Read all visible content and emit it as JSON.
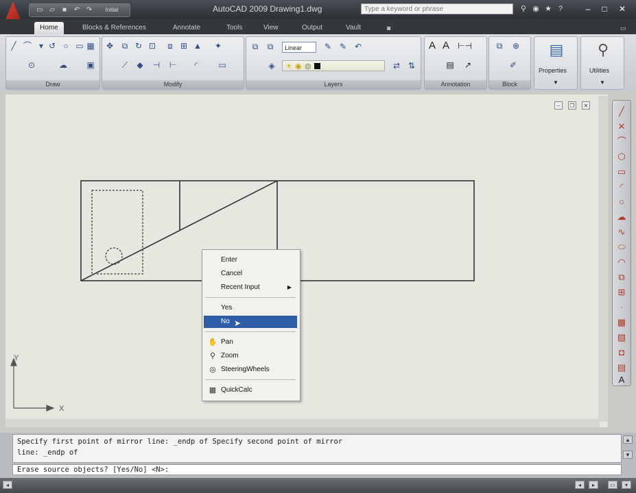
{
  "titlebar": {
    "title": "AutoCAD 2009  Drawing1.dwg",
    "search_placeholder": "Type a keyword or phrase",
    "qat_workspace": "Initial"
  },
  "tabs": [
    "Home",
    "Blocks & References",
    "Annotate",
    "Tools",
    "View",
    "Output",
    "Vault"
  ],
  "ribbon": {
    "panels": {
      "draw": "Draw",
      "modify": "Modify",
      "layers": "Layers",
      "annotation": "Annotation",
      "block": "Block",
      "properties": "Properties",
      "utilities": "Utilities"
    },
    "layer_combo_value": "Linear"
  },
  "context_menu": {
    "items": [
      {
        "label": "Enter",
        "icon": ""
      },
      {
        "label": "Cancel",
        "icon": ""
      },
      {
        "label": "Recent Input",
        "icon": "",
        "submenu": true
      },
      {
        "label": "Yes",
        "icon": ""
      },
      {
        "label": "No",
        "icon": "",
        "highlighted": true
      },
      {
        "label": "Pan",
        "icon": "pan-icon"
      },
      {
        "label": "Zoom",
        "icon": "zoom-icon"
      },
      {
        "label": "SteeringWheels",
        "icon": "steeringwheels-icon"
      },
      {
        "label": "QuickCalc",
        "icon": "quickcalc-icon"
      }
    ],
    "highlight_color": "#2f5ca6"
  },
  "ucs": {
    "x_label": "X",
    "y_label": "Y"
  },
  "command_line": {
    "line1": "Specify first point of mirror line: _endp of Specify second point of mirror",
    "line2": "line: _endp of",
    "prompt": "Erase source objects? [Yes/No] <N>:"
  },
  "colors": {
    "canvas": "#e6e7df",
    "accent": "#2f5ca6",
    "drawing_lines": "#333333"
  }
}
